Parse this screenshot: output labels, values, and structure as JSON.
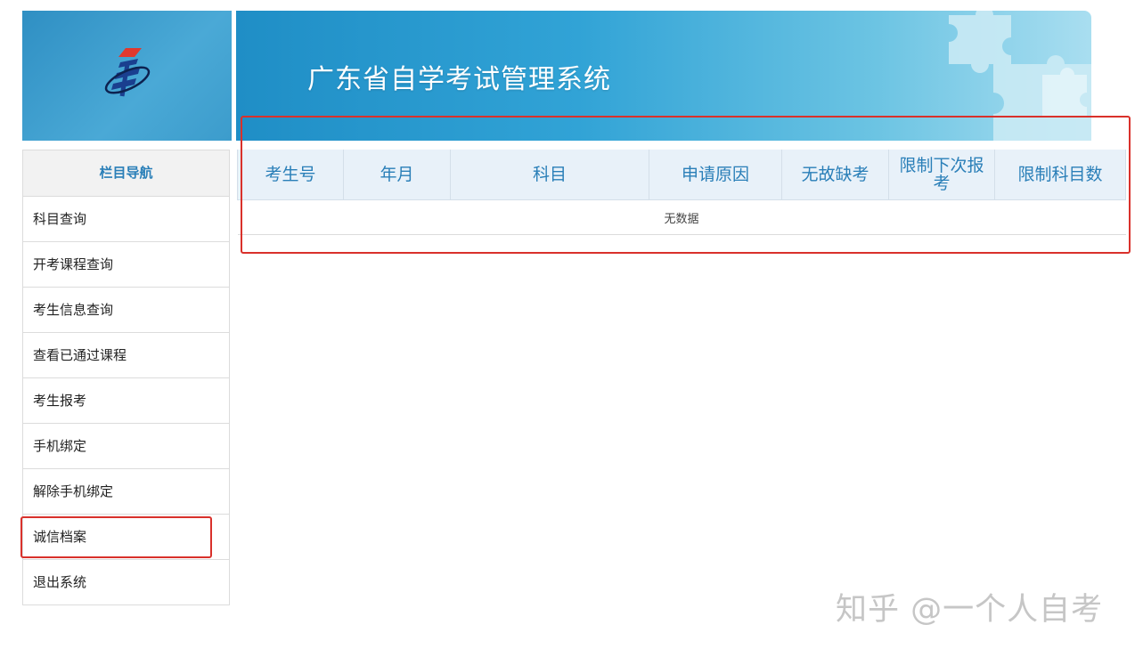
{
  "header": {
    "title": "广东省自学考试管理系统"
  },
  "sidebar": {
    "heading": "栏目导航",
    "items": [
      {
        "label": "科目查询"
      },
      {
        "label": "开考课程查询"
      },
      {
        "label": "考生信息查询"
      },
      {
        "label": "查看已通过课程"
      },
      {
        "label": "考生报考"
      },
      {
        "label": "手机绑定"
      },
      {
        "label": "解除手机绑定"
      },
      {
        "label": "诚信档案"
      },
      {
        "label": "退出系统"
      }
    ]
  },
  "table": {
    "columns": [
      "考生号",
      "年月",
      "科目",
      "申请原因",
      "无故缺考",
      "限制下次报考",
      "限制科目数"
    ],
    "empty_text": "无数据"
  },
  "watermark": "知乎 @一个人自考",
  "colors": {
    "accent": "#2a7fb8",
    "highlight": "#d9312b",
    "header_bg": "#e8f1f9"
  }
}
